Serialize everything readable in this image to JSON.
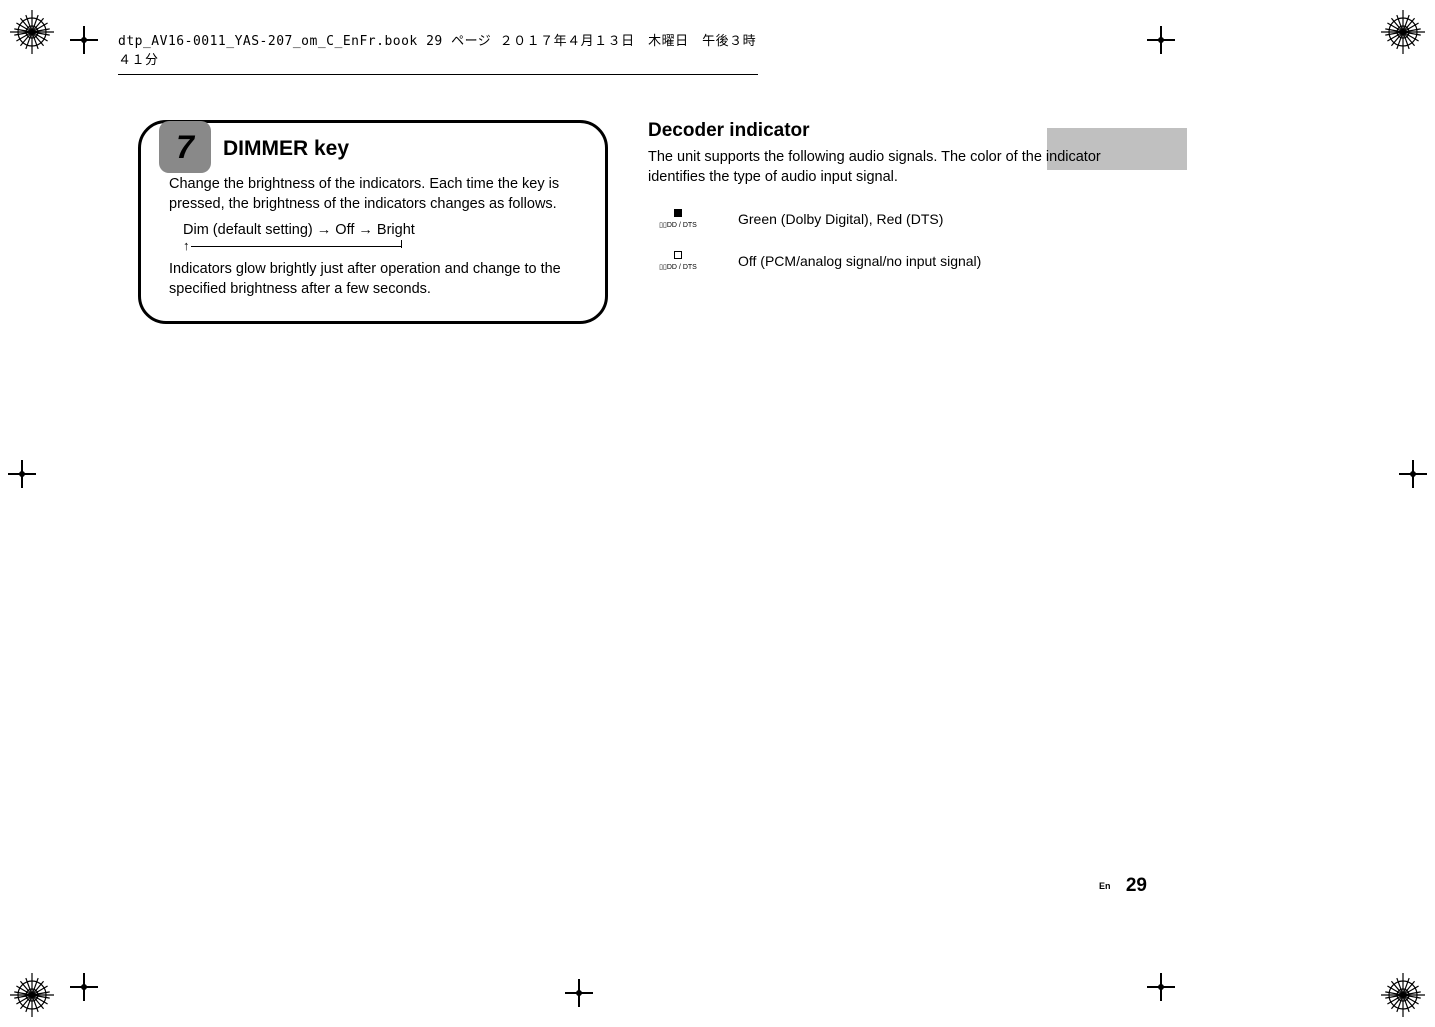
{
  "header": {
    "text": "dtp_AV16-0011_YAS-207_om_C_EnFr.book  29 ページ  ２０１７年４月１３日　木曜日　午後３時４１分"
  },
  "callout": {
    "number": "7",
    "title": "DIMMER key",
    "para1": "Change the brightness of the indicators. Each time the key is pressed, the brightness of the indicators changes as follows.",
    "flow": "Dim (default setting) → Off → Bright",
    "para2": "Indicators glow brightly just after operation and change to the specified brightness after a few seconds."
  },
  "right": {
    "heading": "Decoder indicator",
    "intro": "The unit supports the following audio signals. The color of the indicator identifies the type of audio input signal.",
    "rows": [
      {
        "led_label": "DD / DTS",
        "text": "Green (Dolby Digital), Red (DTS)",
        "filled": true
      },
      {
        "led_label": "DD / DTS",
        "text": "Off (PCM/analog signal/no input signal)",
        "filled": false
      }
    ]
  },
  "footer": {
    "lang": "En",
    "page": "29"
  }
}
